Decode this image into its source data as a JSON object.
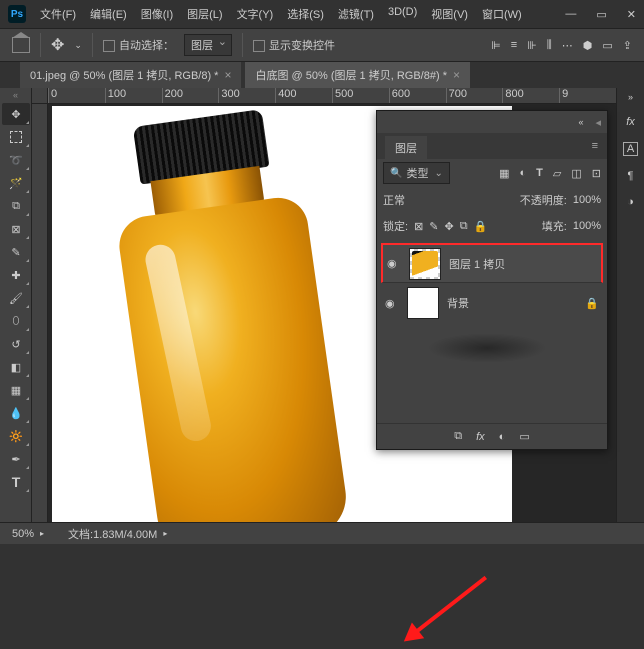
{
  "app_logo": "Ps",
  "menu": {
    "file": "文件(F)",
    "edit": "编辑(E)",
    "image": "图像(I)",
    "layer": "图层(L)",
    "type": "文字(Y)",
    "select": "选择(S)",
    "filter": "滤镜(T)",
    "threeD": "3D(D)",
    "view": "视图(V)",
    "window": "窗口(W)"
  },
  "options": {
    "auto_select": "自动选择：",
    "auto_select_target": "图层",
    "show_transform": "显示变换控件"
  },
  "tabs": [
    {
      "label": "01.jpeg @ 50% (图层 1 拷贝, RGB/8) *"
    },
    {
      "label": "白底图 @ 50% (图层 1 拷贝, RGB/8#) *"
    }
  ],
  "ruler": {
    "marks": [
      "0",
      "100",
      "200",
      "300",
      "400",
      "500",
      "600",
      "700",
      "800",
      "9"
    ]
  },
  "panel": {
    "title": "图层",
    "filter_label": "类型",
    "blend_mode": "正常",
    "opacity_label": "不透明度:",
    "opacity_value": "100%",
    "lock_label": "锁定:",
    "fill_label": "填充:",
    "fill_value": "100%",
    "layers": [
      {
        "name": "图层 1 拷贝",
        "selected": true,
        "visible": true,
        "locked": false
      },
      {
        "name": "背景",
        "selected": false,
        "visible": true,
        "locked": true
      }
    ]
  },
  "status": {
    "zoom": "50%",
    "doc_label": "文档:",
    "doc_info": "1.83M/4.00M"
  },
  "icons": {
    "search": "🔍",
    "eye": "👁",
    "lock": "🔒",
    "fx": "fx",
    "mask": "◐",
    "link": "⧉"
  }
}
